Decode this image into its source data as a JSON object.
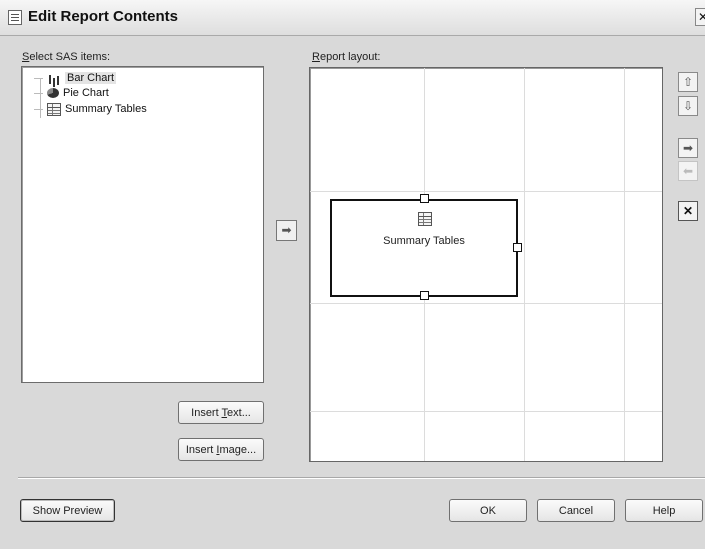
{
  "window": {
    "title": "Edit Report Contents",
    "close_glyph": "✕"
  },
  "left_panel": {
    "label_prefix": "S",
    "label_rest": "elect SAS items:",
    "items": [
      {
        "label": "Bar Chart",
        "icon": "bar-chart-icon",
        "selected": true
      },
      {
        "label": "Pie Chart",
        "icon": "pie-chart-icon",
        "selected": false
      },
      {
        "label": "Summary Tables",
        "icon": "table-icon",
        "selected": false
      }
    ],
    "insert_text": {
      "pre": "Insert ",
      "key": "T",
      "post": "ext..."
    },
    "insert_image": {
      "pre": "Insert ",
      "key": "I",
      "post": "mage..."
    }
  },
  "add_arrow_glyph": "➡",
  "right_panel": {
    "label_prefix": "R",
    "label_rest": "eport layout:",
    "placed_item": {
      "label": "Summary Tables",
      "icon": "table-icon"
    }
  },
  "side_buttons": [
    {
      "name": "move-up-button",
      "glyph": "⇧",
      "disabled": false
    },
    {
      "name": "move-down-button",
      "glyph": "⇩",
      "disabled": false
    },
    {
      "name": "move-right-button",
      "glyph": "➡",
      "disabled": false
    },
    {
      "name": "move-left-button",
      "glyph": "⬅",
      "disabled": true
    },
    {
      "name": "delete-button",
      "glyph": "✕",
      "disabled": false
    }
  ],
  "footer": {
    "show_preview": "Show Preview",
    "ok": "OK",
    "cancel": "Cancel",
    "help": "Help"
  }
}
